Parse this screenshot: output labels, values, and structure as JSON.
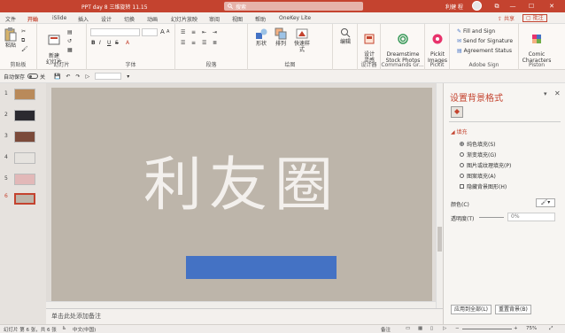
{
  "window": {
    "doc_title": "PPT day 8 三维旋转 11.15",
    "search_placeholder": "搜索",
    "user_name": "利健 程",
    "min": "—",
    "max": "☐",
    "close": "✕",
    "restore": "⧉"
  },
  "tabs": [
    "文件",
    "开始",
    "iSlide",
    "插入",
    "设计",
    "切换",
    "动画",
    "幻灯片放映",
    "审阅",
    "视图",
    "帮助",
    "OneKey Lite"
  ],
  "active_tab": "开始",
  "share_label": "共享",
  "comment_label": "批注",
  "ribbon": {
    "clipboard": {
      "paste": "粘贴",
      "label": "剪贴板"
    },
    "slides": {
      "new_slide": "新建\n幻灯片",
      "label": "幻灯片"
    },
    "font": {
      "label": "字体",
      "bold": "B",
      "italic": "I",
      "underline": "U",
      "strike": "S",
      "grow": "A",
      "shrink": "A"
    },
    "paragraph": {
      "label": "段落"
    },
    "drawing": {
      "shape": "形状",
      "arrange": "排列",
      "quick_styles": "快速样式",
      "label": "绘图"
    },
    "editing": {
      "edit": "编辑",
      "label": ""
    },
    "designer": {
      "idea": "设计\n灵感",
      "label": "设计器"
    },
    "dreamstime": {
      "btn": "Dreamstime\nStock Photos",
      "label": "Commands Gr..."
    },
    "pickit": {
      "btn": "Pickit\nImages",
      "label": "Pickit"
    },
    "adobe": {
      "fill_sign": "Fill and Sign",
      "send_sig": "Send for Signature",
      "agreement": "Agreement Status",
      "label": "Adobe Sign"
    },
    "piston": {
      "btn": "Comic\nCharacters",
      "label": "Piston"
    }
  },
  "qat": {
    "autosave": "自动保存",
    "autosave_state": "关",
    "undo": "↶",
    "redo": "↷"
  },
  "thumbnails": [
    {
      "num": "1",
      "color": "#b98a5a"
    },
    {
      "num": "2",
      "color": "#2b2a30"
    },
    {
      "num": "3",
      "color": "#7b4a3a"
    },
    {
      "num": "4",
      "color": "#e6e3df"
    },
    {
      "num": "5",
      "color": "#e2b8b8"
    },
    {
      "num": "6",
      "color": "#bdb5aa"
    }
  ],
  "active_slide": "6",
  "slide": {
    "title": "利友圈",
    "bg": "#bdb5aa",
    "bar_color": "#4472c4"
  },
  "notes_placeholder": "单击此处添加备注",
  "format_pane": {
    "title": "设置背景格式",
    "section": "填充",
    "options": [
      {
        "label": "纯色填充(S)",
        "type": "radio",
        "checked": true
      },
      {
        "label": "渐变填充(G)",
        "type": "radio",
        "checked": false
      },
      {
        "label": "图片或纹理填充(P)",
        "type": "radio",
        "checked": false
      },
      {
        "label": "图案填充(A)",
        "type": "radio",
        "checked": false
      },
      {
        "label": "隐藏背景图形(H)",
        "type": "check",
        "checked": false
      }
    ],
    "color_label": "颜色(C)",
    "transparency_label": "透明度(T)",
    "transparency_value": "0%",
    "apply_all": "应用到全部(L)",
    "reset_bg": "重置背景(B)"
  },
  "status": {
    "slide_info": "幻灯片 第 6 张，共 6 张",
    "language": "中文(中国)",
    "notes": "备注",
    "zoom": "75%"
  }
}
